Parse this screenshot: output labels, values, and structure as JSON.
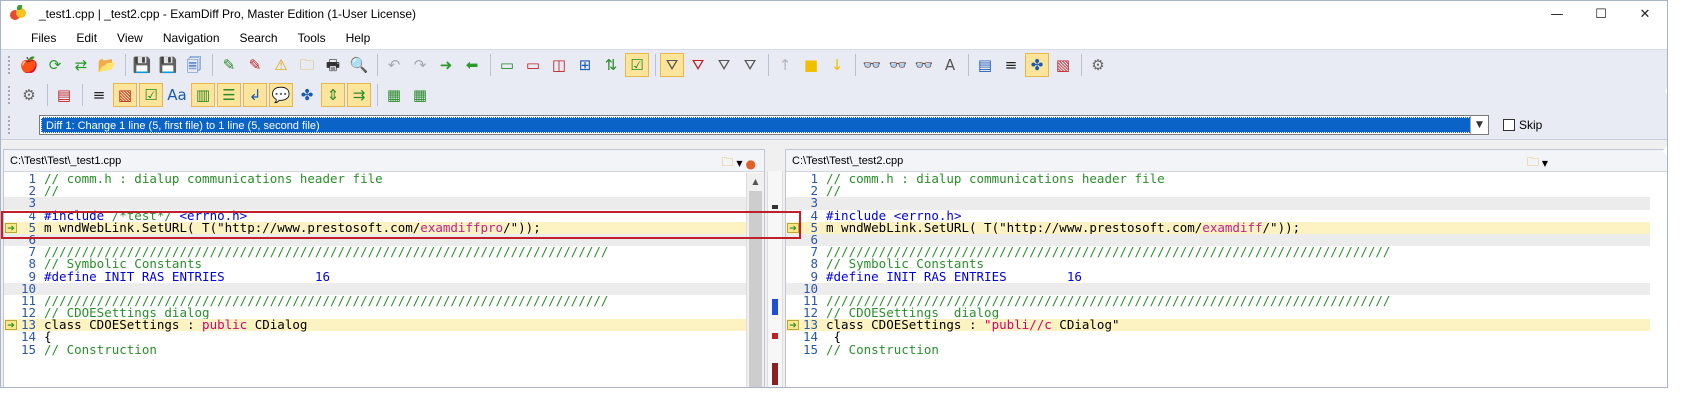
{
  "window": {
    "title": "_test1.cpp  |  _test2.cpp - ExamDiff Pro, Master Edition (1-User License)",
    "controls": {
      "minimize": "—",
      "maximize": "☐",
      "close": "✕"
    }
  },
  "menu": [
    "Files",
    "Edit",
    "View",
    "Navigation",
    "Search",
    "Tools",
    "Help"
  ],
  "toolbar1": [
    {
      "icon": "open-files-icon",
      "glyph": "🍎"
    },
    {
      "icon": "refresh-icon",
      "glyph": "⟳"
    },
    {
      "icon": "swap-files-icon",
      "glyph": "⇄"
    },
    {
      "icon": "open-folder-icon",
      "glyph": "📂"
    },
    {
      "icon": "save-icon",
      "glyph": "💾"
    },
    {
      "icon": "save-red-icon",
      "glyph": "💾"
    },
    {
      "icon": "save-all-icon",
      "glyph": "🗐"
    },
    {
      "icon": "edit-icon",
      "glyph": "✎"
    },
    {
      "icon": "edit-red-icon",
      "glyph": "✎"
    },
    {
      "icon": "warning-icon",
      "glyph": "⚠"
    },
    {
      "icon": "folder-warning-icon",
      "glyph": "🗀"
    },
    {
      "icon": "print-icon",
      "glyph": "🖶"
    },
    {
      "icon": "print-preview-icon",
      "glyph": "🔍"
    },
    {
      "icon": "undo-icon",
      "glyph": "↶"
    },
    {
      "icon": "redo-icon",
      "glyph": "↷"
    },
    {
      "icon": "copy-right-icon",
      "glyph": "➜"
    },
    {
      "icon": "copy-left-icon",
      "glyph": "⬅"
    },
    {
      "icon": "pane-single-icon",
      "glyph": "▭"
    },
    {
      "icon": "pane-red-icon",
      "glyph": "▭"
    },
    {
      "icon": "pane-split-icon",
      "glyph": "◫"
    },
    {
      "icon": "pane-grid-icon",
      "glyph": "⊞"
    },
    {
      "icon": "sync-scroll-icon",
      "glyph": "⇅"
    },
    {
      "icon": "checkbox-icon",
      "glyph": "☑"
    },
    {
      "icon": "filter-icon",
      "glyph": "⛛"
    },
    {
      "icon": "filter-minus-icon",
      "glyph": "⛛"
    },
    {
      "icon": "filter-equal-icon",
      "glyph": "⛛"
    },
    {
      "icon": "filter-clear-icon",
      "glyph": "⛛"
    },
    {
      "icon": "prev-diff-icon",
      "glyph": "↑"
    },
    {
      "icon": "current-diff-icon",
      "glyph": "■"
    },
    {
      "icon": "next-diff-icon",
      "glyph": "↓"
    },
    {
      "icon": "find-icon",
      "glyph": "👓"
    },
    {
      "icon": "find-next-icon",
      "glyph": "👓"
    },
    {
      "icon": "find-prev-icon",
      "glyph": "👓"
    },
    {
      "icon": "match-case-icon",
      "glyph": "A"
    },
    {
      "icon": "layout-icon",
      "glyph": "▤"
    },
    {
      "icon": "text-lines-icon",
      "glyph": "≡"
    },
    {
      "icon": "puzzle-icon",
      "glyph": "✤"
    },
    {
      "icon": "compare-chart-icon",
      "glyph": "▧"
    },
    {
      "icon": "settings-icon",
      "glyph": "⚙"
    }
  ],
  "toolbar2": [
    {
      "icon": "options-icon",
      "glyph": "⚙"
    },
    {
      "icon": "layout-icon",
      "glyph": "▤"
    },
    {
      "icon": "text-lines-icon",
      "glyph": "≡"
    },
    {
      "icon": "compare-chart-icon",
      "glyph": "▧"
    },
    {
      "icon": "checkbox-icon",
      "glyph": "☑"
    },
    {
      "icon": "font-icon",
      "glyph": "Aa"
    },
    {
      "icon": "bars-icon",
      "glyph": "▥"
    },
    {
      "icon": "list-icon",
      "glyph": "☰"
    },
    {
      "icon": "undo-blue-icon",
      "glyph": "↲"
    },
    {
      "icon": "comment-icon",
      "glyph": "💬"
    },
    {
      "icon": "puzzle-icon",
      "glyph": "✤"
    },
    {
      "icon": "merge-icon",
      "glyph": "⇕"
    },
    {
      "icon": "merge-right-icon",
      "glyph": "⇉"
    },
    {
      "icon": "report-icon",
      "glyph": "▦"
    },
    {
      "icon": "report-dropdown-icon",
      "glyph": "▦"
    }
  ],
  "diff_selector": {
    "value": "Diff 1: Change 1 line (5, first file) to 1 line (5, second file)",
    "skip_label": "Skip"
  },
  "left_pane": {
    "path": "C:\\Test\\Test\\_test1.cpp",
    "lines": [
      {
        "n": "1",
        "parts": [
          {
            "t": "// comm.h : dialup communications header file",
            "c": "c-com"
          }
        ]
      },
      {
        "n": "2",
        "parts": [
          {
            "t": "//",
            "c": "c-com"
          }
        ]
      },
      {
        "n": "3",
        "parts": []
      },
      {
        "n": "4",
        "parts": [
          {
            "t": "#include ",
            "c": "c-pp"
          },
          {
            "t": "/*test*/",
            "c": "c-com"
          },
          {
            "t": " <errno.h>",
            "c": "c-pp"
          }
        ]
      },
      {
        "n": "5",
        "parts": [
          {
            "t": "m_wndWebLink.SetURL(_T(\"http://www.prestosoft.com/",
            "c": "c-str"
          },
          {
            "t": "examdiffpro",
            "c": "c-diff"
          },
          {
            "t": "/\"));",
            "c": "c-str"
          }
        ]
      },
      {
        "n": "6",
        "parts": []
      },
      {
        "n": "7",
        "parts": [
          {
            "t": "///////////////////////////////////////////////////////////////////////////",
            "c": "c-com"
          }
        ]
      },
      {
        "n": "8",
        "parts": [
          {
            "t": "// Symbolic Constants",
            "c": "c-com"
          }
        ]
      },
      {
        "n": "9",
        "parts": [
          {
            "t": "#define INIT_RAS_ENTRIES            ",
            "c": "c-pp"
          },
          {
            "t": "16",
            "c": "c-num"
          }
        ]
      },
      {
        "n": "10",
        "parts": []
      },
      {
        "n": "11",
        "parts": [
          {
            "t": "///////////////////////////////////////////////////////////////////////////",
            "c": "c-com"
          }
        ]
      },
      {
        "n": "12",
        "parts": [
          {
            "t": "// CDOESettings dialog",
            "c": "c-com"
          }
        ]
      },
      {
        "n": "13",
        "parts": [
          {
            "t": "class CDOESettings : ",
            "c": "c-str"
          },
          {
            "t": "public",
            "c": "c-pink"
          },
          {
            "t": " CDialog",
            "c": "c-str"
          }
        ]
      },
      {
        "n": "14",
        "parts": [
          {
            "t": "{",
            "c": "c-str"
          }
        ]
      },
      {
        "n": "15",
        "parts": [
          {
            "t": "// Construction",
            "c": "c-com"
          }
        ]
      }
    ]
  },
  "right_pane": {
    "path": "C:\\Test\\Test\\_test2.cpp",
    "lines": [
      {
        "n": "1",
        "parts": [
          {
            "t": "// comm.h : dialup communications header file",
            "c": "c-com"
          }
        ]
      },
      {
        "n": "2",
        "parts": [
          {
            "t": "//",
            "c": "c-com"
          }
        ]
      },
      {
        "n": "3",
        "parts": []
      },
      {
        "n": "4",
        "parts": [
          {
            "t": "#include ",
            "c": "c-pp"
          },
          {
            "t": "<errno.h>",
            "c": "c-pp"
          }
        ]
      },
      {
        "n": "5",
        "parts": [
          {
            "t": "m_wndWebLink.SetURL(_T(\"http://www.prestosoft.com/",
            "c": "c-str"
          },
          {
            "t": "examdiff",
            "c": "c-diff"
          },
          {
            "t": "/\"));",
            "c": "c-str"
          }
        ]
      },
      {
        "n": "6",
        "parts": []
      },
      {
        "n": "7",
        "parts": [
          {
            "t": "///////////////////////////////////////////////////////////////////////////",
            "c": "c-com"
          }
        ]
      },
      {
        "n": "8",
        "parts": [
          {
            "t": "// Symbolic Constants",
            "c": "c-com"
          }
        ]
      },
      {
        "n": "9",
        "parts": [
          {
            "t": "#define INIT_RAS_ENTRIES        ",
            "c": "c-pp"
          },
          {
            "t": "16",
            "c": "c-num"
          }
        ]
      },
      {
        "n": "10",
        "parts": []
      },
      {
        "n": "11",
        "parts": [
          {
            "t": "///////////////////////////////////////////////////////////////////////////",
            "c": "c-com"
          }
        ]
      },
      {
        "n": "12",
        "parts": [
          {
            "t": "// CDOESettings  dialog",
            "c": "c-com"
          }
        ]
      },
      {
        "n": "13",
        "parts": [
          {
            "t": "class CDOESettings : ",
            "c": "c-str"
          },
          {
            "t": "\"publi//c",
            "c": "c-pink"
          },
          {
            "t": " CDialog\"",
            "c": "c-str"
          }
        ]
      },
      {
        "n": "14",
        "parts": [
          {
            "t": " {",
            "c": "c-str"
          }
        ]
      },
      {
        "n": "15",
        "parts": [
          {
            "t": "// Construction",
            "c": "c-com"
          }
        ]
      }
    ]
  },
  "colors": {
    "changed_line": "#fdf3c2",
    "diff_text": "#c0208a",
    "selected_diff": "#0a64c8",
    "highlight_box": "#c0202a"
  }
}
